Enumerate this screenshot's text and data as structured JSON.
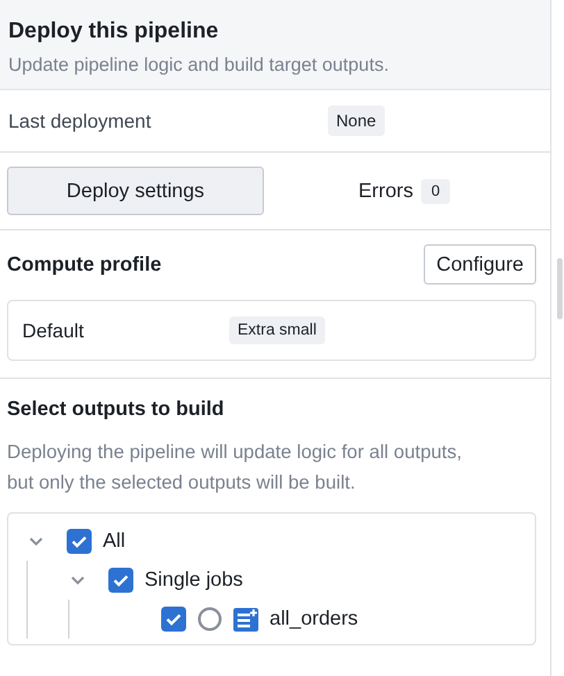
{
  "header": {
    "title": "Deploy this pipeline",
    "subtitle": "Update pipeline logic and build target outputs."
  },
  "last_deployment": {
    "label": "Last deployment",
    "value": "None"
  },
  "deploy_button": "Deploy settings",
  "errors": {
    "label": "Errors",
    "count": "0"
  },
  "compute_profile": {
    "title": "Compute profile",
    "button": "Configure",
    "name": "Default",
    "size": "Extra small"
  },
  "outputs": {
    "title": "Select outputs to build",
    "description": [
      "Deploying the pipeline will update logic for all outputs,",
      "but only the selected outputs will be built."
    ],
    "tree": [
      {
        "label": "All",
        "checked": true,
        "expanded": true,
        "children": [
          {
            "label": "Single jobs",
            "checked": true,
            "expanded": true,
            "children": [
              {
                "label": "all_orders",
                "checked": true,
                "kind": "dataset",
                "selected": false
              }
            ]
          }
        ]
      }
    ]
  }
}
